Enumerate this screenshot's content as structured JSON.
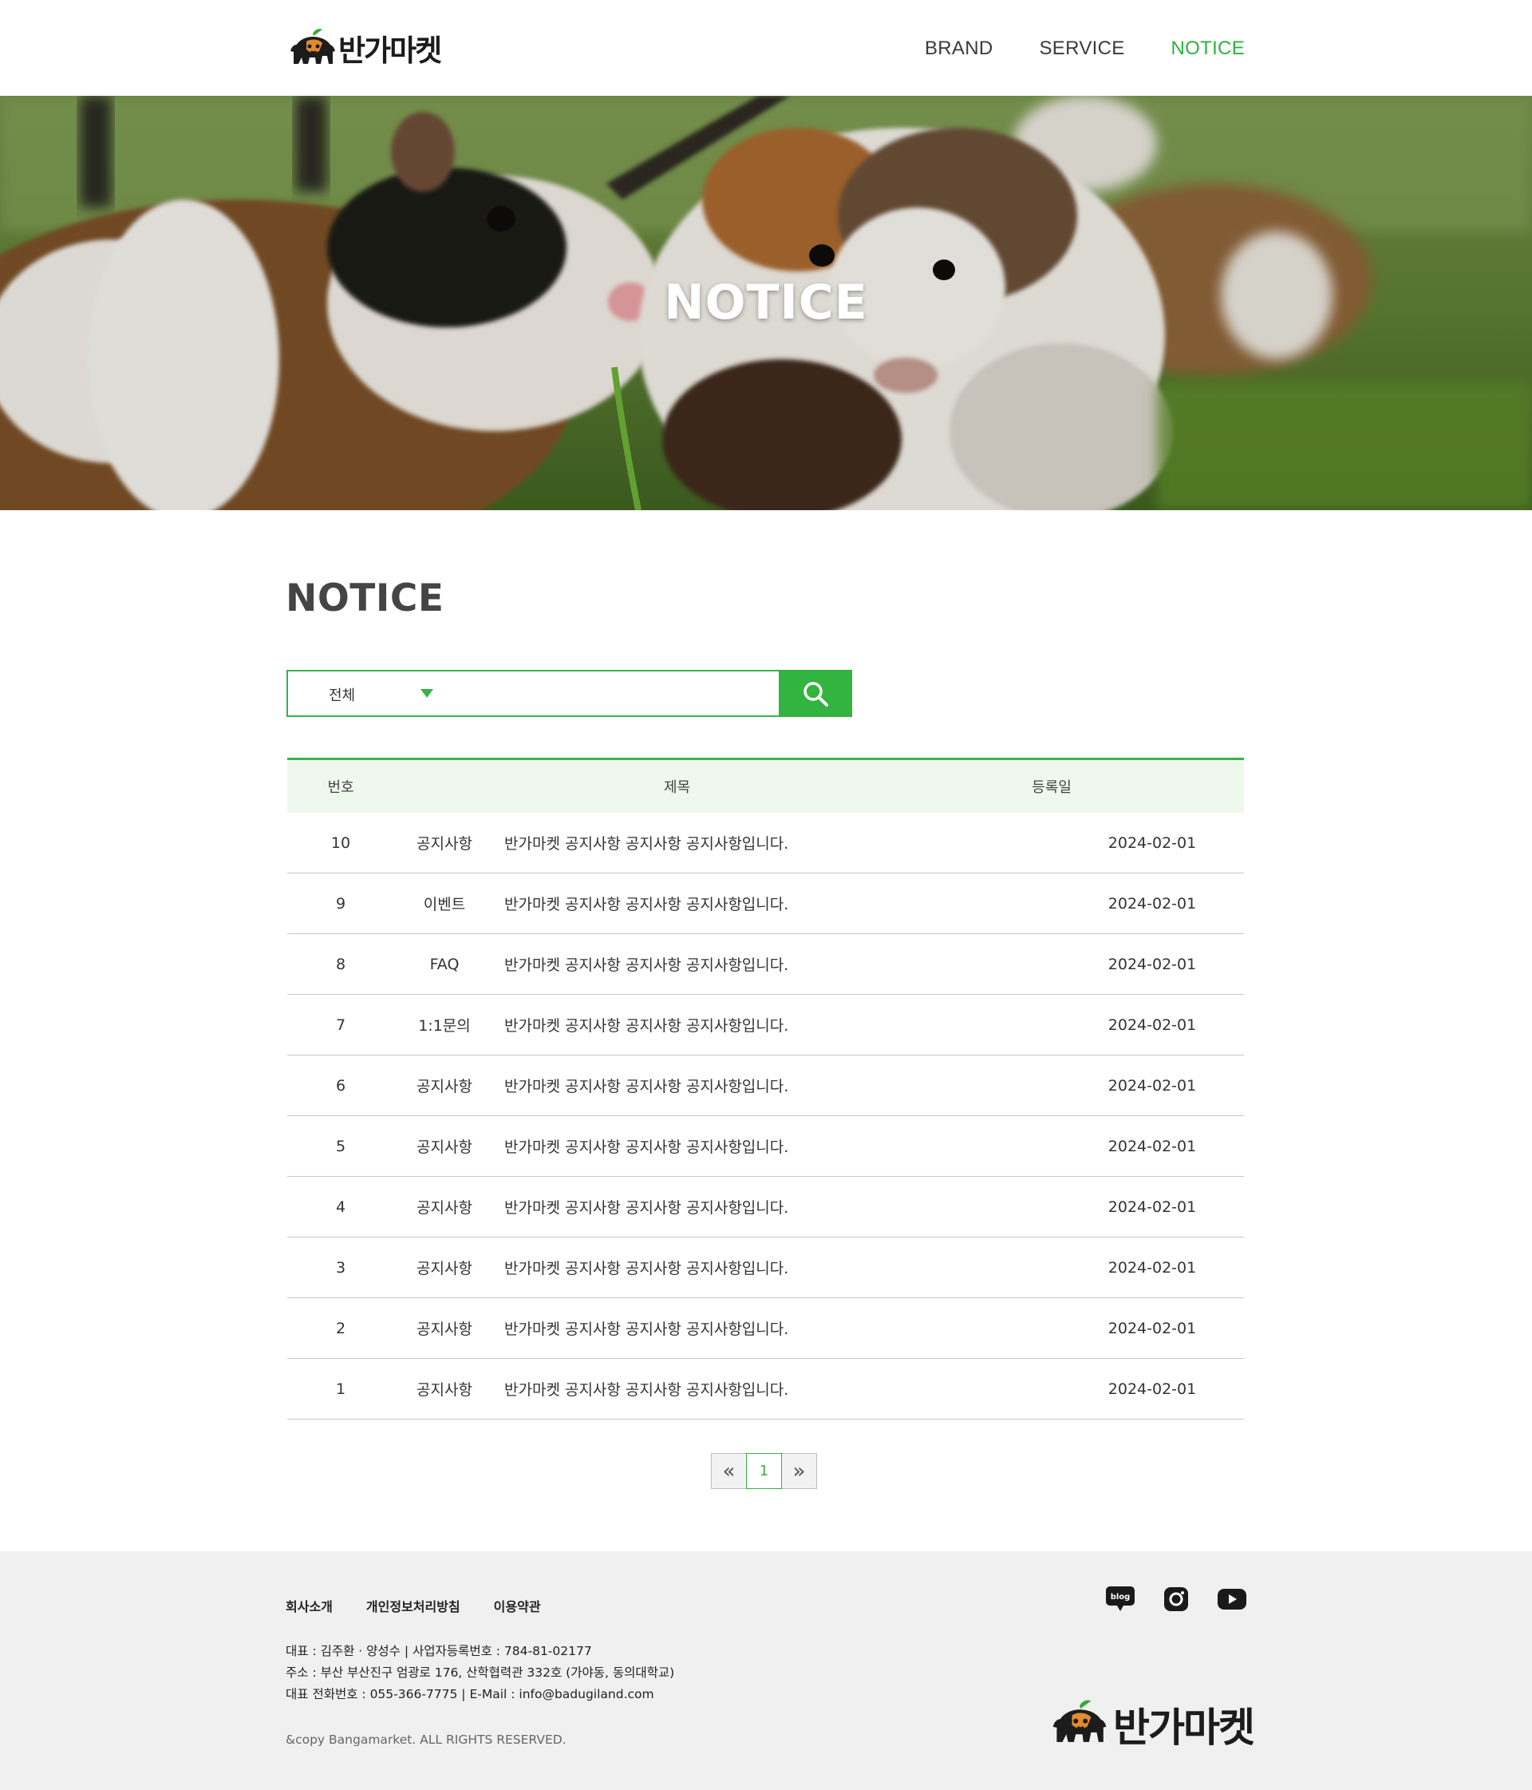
{
  "header": {
    "brand": "반가마켓",
    "nav": [
      {
        "label": "BRAND",
        "active": false
      },
      {
        "label": "SERVICE",
        "active": false
      },
      {
        "label": "NOTICE",
        "active": true
      }
    ]
  },
  "hero": {
    "title": "NOTICE"
  },
  "main": {
    "title": "NOTICE",
    "search": {
      "category": "전체",
      "button_icon": "search-icon"
    },
    "table": {
      "headers": [
        "번호",
        "제목",
        "등록일"
      ],
      "rows": [
        {
          "num": "10",
          "category": "공지사항",
          "title": "반가마켓 공지사항 공지사항 공지사항입니다.",
          "date": "2024-02-01"
        },
        {
          "num": "9",
          "category": "이벤트",
          "title": "반가마켓 공지사항 공지사항 공지사항입니다.",
          "date": "2024-02-01"
        },
        {
          "num": "8",
          "category": "FAQ",
          "title": "반가마켓 공지사항 공지사항 공지사항입니다.",
          "date": "2024-02-01"
        },
        {
          "num": "7",
          "category": "1:1문의",
          "title": "반가마켓 공지사항 공지사항 공지사항입니다.",
          "date": "2024-02-01"
        },
        {
          "num": "6",
          "category": "공지사항",
          "title": "반가마켓 공지사항 공지사항 공지사항입니다.",
          "date": "2024-02-01"
        },
        {
          "num": "5",
          "category": "공지사항",
          "title": "반가마켓 공지사항 공지사항 공지사항입니다.",
          "date": "2024-02-01"
        },
        {
          "num": "4",
          "category": "공지사항",
          "title": "반가마켓 공지사항 공지사항 공지사항입니다.",
          "date": "2024-02-01"
        },
        {
          "num": "3",
          "category": "공지사항",
          "title": "반가마켓 공지사항 공지사항 공지사항입니다.",
          "date": "2024-02-01"
        },
        {
          "num": "2",
          "category": "공지사항",
          "title": "반가마켓 공지사항 공지사항 공지사항입니다.",
          "date": "2024-02-01"
        },
        {
          "num": "1",
          "category": "공지사항",
          "title": "반가마켓 공지사항 공지사항 공지사항입니다.",
          "date": "2024-02-01"
        }
      ]
    },
    "pagination": {
      "prev": "«",
      "current": "1",
      "next": "»"
    }
  },
  "footer": {
    "links": [
      "회사소개",
      "개인정보처리방침",
      "이용약관"
    ],
    "info": [
      "대표 : 김주환 · 양성수 | 사업자등록번호 : 784-81-02177",
      "주소 : 부산 부산진구 엄광로 176, 산학협력관 332호 (가야동, 동의대학교)",
      "대표 전화번호 : 055-366-7775 | E-Mail : info@badugiland.com"
    ],
    "copyright": "&copy Bangamarket. ALL RIGHTS RESERVED.",
    "sns": [
      "blog-icon",
      "instagram-icon",
      "youtube-icon"
    ],
    "brand": "반가마켓",
    "sns_blog_label": "blog"
  },
  "colors": {
    "accent": "#36b34a",
    "header_bg": "#eef8ec",
    "footer_bg": "#f0f0f0"
  }
}
